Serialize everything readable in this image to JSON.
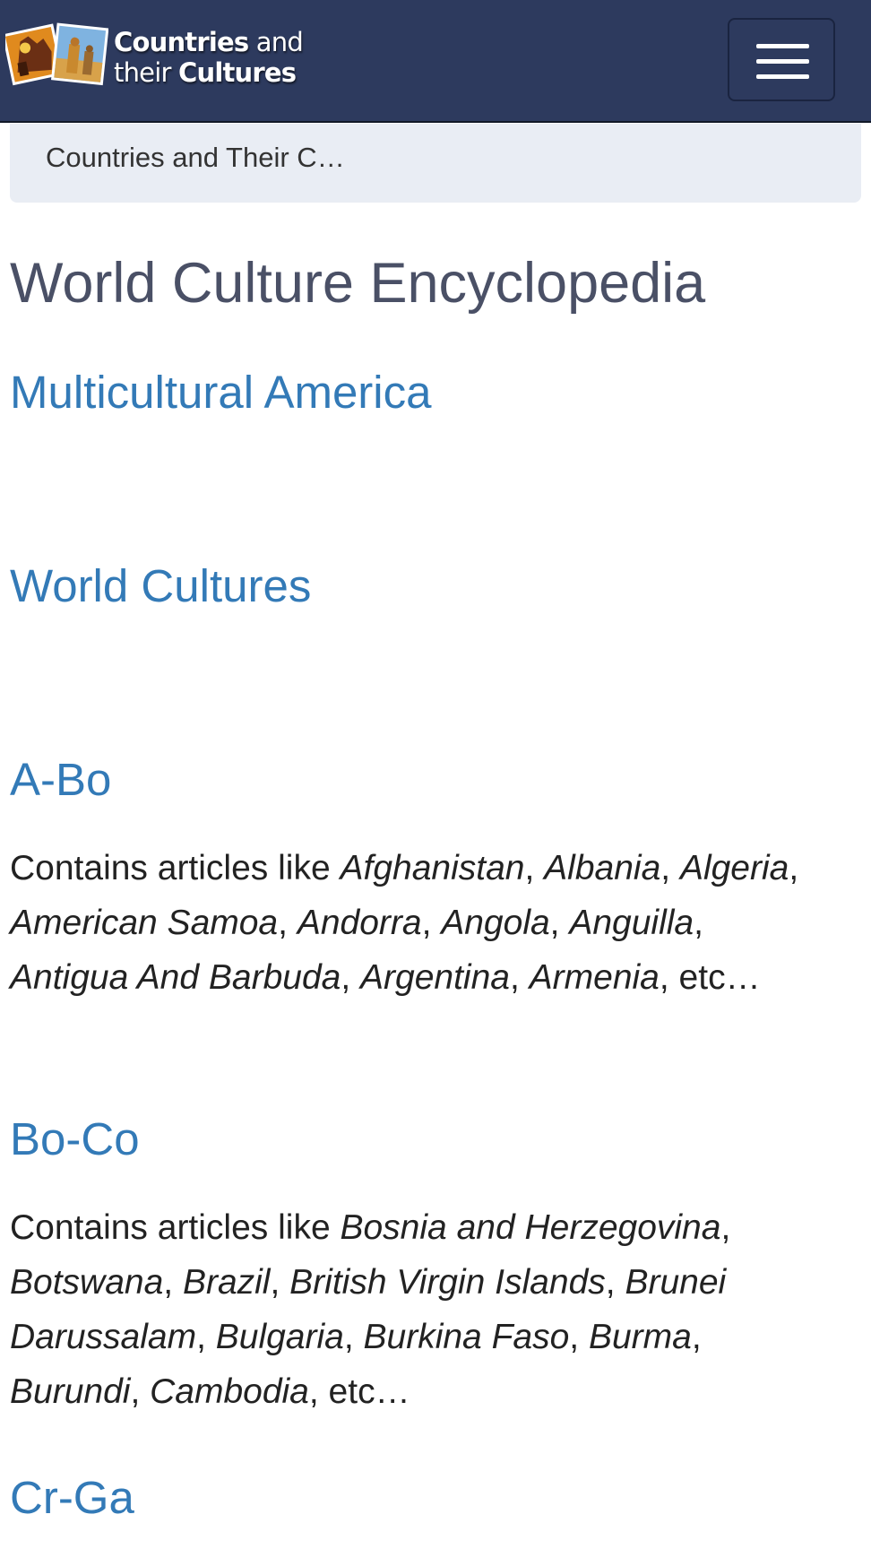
{
  "header": {
    "logo_line1_bold": "Countries",
    "logo_line1_thin": " and",
    "logo_line2_thin": "their ",
    "logo_line2_bold": "Cultures",
    "menu_icon": "hamburger-menu-icon"
  },
  "breadcrumb": {
    "text": "Countries and Their C…"
  },
  "main": {
    "title": "World Culture Encyclopedia",
    "links": {
      "multicultural": "Multicultural America",
      "world_cultures": "World Cultures"
    },
    "sections": [
      {
        "heading": "A-Bo",
        "prefix": "Contains articles like ",
        "items": [
          "Afghanistan",
          "Albania",
          "Algeria",
          "American Samoa",
          "Andorra",
          "Angola",
          "Anguilla",
          "Antigua And Barbuda",
          "Argentina",
          "Armenia"
        ],
        "suffix": ", etc…"
      },
      {
        "heading": "Bo-Co",
        "prefix": "Contains articles like ",
        "items": [
          "Bosnia and Herzegovina",
          "Botswana",
          "Brazil",
          "British Virgin Islands",
          "Brunei Darussalam",
          "Bulgaria",
          "Burkina Faso",
          "Burma",
          "Burundi",
          "Cambodia"
        ],
        "suffix": ", etc…"
      },
      {
        "heading": "Cr-Ga"
      }
    ]
  },
  "colors": {
    "navbar": "#2d3a5e",
    "link": "#337ab7",
    "breadcrumb_bg": "#e9edf4",
    "title": "#4a5066"
  }
}
